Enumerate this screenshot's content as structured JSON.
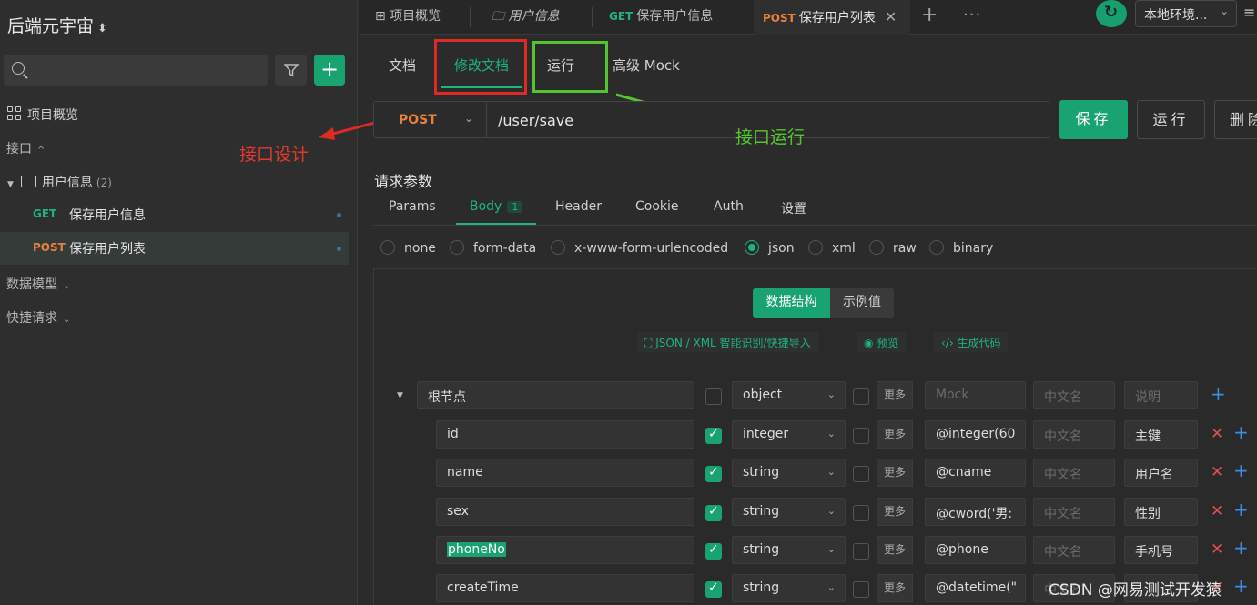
{
  "sidebar": {
    "project_title": "后端元宇宙",
    "project_chevron": "⌄",
    "overview": "项目概览",
    "section_api": "接口",
    "folder_name": "用户信息",
    "folder_count": "(2)",
    "apis": [
      {
        "method": "GET",
        "name": "保存用户信息",
        "method_color": "#1fb37e"
      },
      {
        "method": "POST",
        "name": "保存用户列表",
        "method_color": "#e8813b"
      }
    ],
    "section_models": "数据模型",
    "section_quick": "快捷请求"
  },
  "annotations": {
    "design": "接口设计",
    "run": "接口运行"
  },
  "topbar": {
    "tabs": [
      {
        "label": "项目概览"
      },
      {
        "label": "用户信息"
      },
      {
        "method": "GET",
        "label": "保存用户信息"
      },
      {
        "method": "POST",
        "label": "保存用户列表"
      }
    ],
    "env": "本地环境...",
    "plus": "+",
    "dots": "···"
  },
  "subtabs": [
    "文档",
    "修改文档",
    "运行",
    "高级 Mock"
  ],
  "url": {
    "method": "POST",
    "path": "/user/save",
    "save": "保存",
    "run": "运行",
    "delete": "删除"
  },
  "request": {
    "title": "请求参数",
    "tabs": [
      "Params",
      "Body",
      "Header",
      "Cookie",
      "Auth",
      "设置"
    ],
    "body_badge": "1",
    "body_types": [
      "none",
      "form-data",
      "x-www-form-urlencoded",
      "json",
      "xml",
      "raw",
      "binary"
    ],
    "selected_body_type": "json"
  },
  "editor": {
    "seg_on": "数据结构",
    "seg_off": "示例值",
    "tools": [
      "JSON / XML 智能识别/快捷导入",
      "预览",
      "生成代码"
    ],
    "more": "更多",
    "root": {
      "name": "根节点",
      "type": "object",
      "mock_ph": "Mock",
      "cn_ph": "中文名",
      "desc_ph": "说明"
    },
    "fields": [
      {
        "name": "id",
        "type": "integer",
        "mock": "@integer(60",
        "cn": "中文名",
        "desc": "主键"
      },
      {
        "name": "name",
        "type": "string",
        "mock": "@cname",
        "cn": "中文名",
        "desc": "用户名"
      },
      {
        "name": "sex",
        "type": "string",
        "mock": "@cword('男:",
        "cn": "中文名",
        "desc": "性别"
      },
      {
        "name": "phoneNo",
        "type": "string",
        "mock": "@phone",
        "cn": "中文名",
        "desc": "手机号"
      },
      {
        "name": "createTime",
        "type": "string",
        "mock": "@datetime(\"",
        "cn": "中文名",
        "desc": ""
      }
    ]
  },
  "watermark": "CSDN @网易测试开发猿"
}
